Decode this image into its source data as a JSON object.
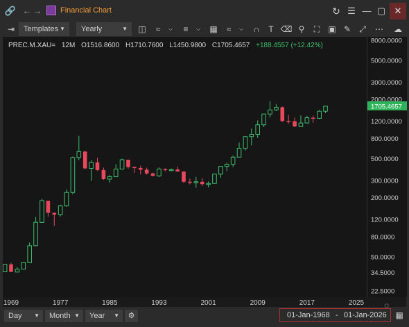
{
  "window": {
    "title": "Financial Chart"
  },
  "toolbar": {
    "templates_label": "Templates",
    "interval_label": "Yearly"
  },
  "legend": {
    "symbol": "PREC.M.XAU=",
    "period": "12M",
    "open": "O1516.8600",
    "high": "H1710.7600",
    "low": "L1450.9800",
    "close": "C1705.4657",
    "change": "+188.4557 (+12.42%)"
  },
  "price_tag": "1705.4657",
  "yaxis_labels": [
    "8000.0000",
    "5000.0000",
    "3000.0000",
    "2000.0000",
    "1200.0000",
    "800.0000",
    "500.0000",
    "300.0000",
    "200.0000",
    "120.0000",
    "80.0000",
    "50.0000",
    "34.5000",
    "22.5000"
  ],
  "xaxis_labels": [
    "1969",
    "1977",
    "1985",
    "1993",
    "2001",
    "2009",
    "2017",
    "2025"
  ],
  "bottom": {
    "day": "Day",
    "month": "Month",
    "year": "Year",
    "date_from": "01-Jan-1968",
    "date_sep": "-",
    "date_to": "01-Jan-2026"
  },
  "colors": {
    "up": "#3fbf6f",
    "down": "#e8485e",
    "accent": "#f29a3a"
  },
  "chart_data": {
    "type": "candlestick",
    "scale": "log",
    "ylim": [
      22.5,
      8000
    ],
    "xlim": [
      1968,
      2026
    ],
    "grid": false,
    "candles": [
      {
        "x": 1968,
        "o": 35.2,
        "h": 42,
        "l": 34.8,
        "c": 41.9
      },
      {
        "x": 1969,
        "o": 41.9,
        "h": 43.5,
        "l": 34.9,
        "c": 35.2
      },
      {
        "x": 1970,
        "o": 35.0,
        "h": 39.2,
        "l": 34.8,
        "c": 37.4
      },
      {
        "x": 1971,
        "o": 37.4,
        "h": 44,
        "l": 37.3,
        "c": 43.6
      },
      {
        "x": 1972,
        "o": 43.7,
        "h": 70,
        "l": 43.6,
        "c": 64.9
      },
      {
        "x": 1973,
        "o": 64.9,
        "h": 127,
        "l": 63.9,
        "c": 112.3
      },
      {
        "x": 1974,
        "o": 112,
        "h": 195,
        "l": 111,
        "c": 186.5
      },
      {
        "x": 1975,
        "o": 186,
        "h": 186,
        "l": 128,
        "c": 140.3
      },
      {
        "x": 1976,
        "o": 140,
        "h": 141,
        "l": 103,
        "c": 134.5
      },
      {
        "x": 1977,
        "o": 134.5,
        "h": 169,
        "l": 129,
        "c": 164.9
      },
      {
        "x": 1978,
        "o": 165,
        "h": 243,
        "l": 161,
        "c": 226
      },
      {
        "x": 1979,
        "o": 226,
        "h": 524,
        "l": 216,
        "c": 512
      },
      {
        "x": 1980,
        "o": 512,
        "h": 850,
        "l": 481,
        "c": 589.5
      },
      {
        "x": 1981,
        "o": 589.5,
        "h": 599,
        "l": 391,
        "c": 397.5
      },
      {
        "x": 1982,
        "o": 397.5,
        "h": 481,
        "l": 297,
        "c": 456.9
      },
      {
        "x": 1983,
        "o": 456.9,
        "h": 509,
        "l": 374,
        "c": 382.4
      },
      {
        "x": 1984,
        "o": 382.4,
        "h": 405,
        "l": 303,
        "c": 309
      },
      {
        "x": 1985,
        "o": 309,
        "h": 340,
        "l": 284,
        "c": 326.8
      },
      {
        "x": 1986,
        "o": 326.8,
        "h": 438,
        "l": 326,
        "c": 390.9
      },
      {
        "x": 1987,
        "o": 390.9,
        "h": 499,
        "l": 390,
        "c": 486.5
      },
      {
        "x": 1988,
        "o": 486.5,
        "h": 485,
        "l": 395,
        "c": 410.2
      },
      {
        "x": 1989,
        "o": 410.2,
        "h": 416,
        "l": 356,
        "c": 401
      },
      {
        "x": 1990,
        "o": 401,
        "h": 423,
        "l": 345,
        "c": 385
      },
      {
        "x": 1991,
        "o": 385,
        "h": 403,
        "l": 344,
        "c": 353.2
      },
      {
        "x": 1992,
        "o": 353.2,
        "h": 360,
        "l": 330,
        "c": 333
      },
      {
        "x": 1993,
        "o": 333,
        "h": 406,
        "l": 326,
        "c": 391.8
      },
      {
        "x": 1994,
        "o": 391.8,
        "h": 397,
        "l": 370,
        "c": 383.3
      },
      {
        "x": 1995,
        "o": 383.3,
        "h": 396,
        "l": 372,
        "c": 387
      },
      {
        "x": 1996,
        "o": 387,
        "h": 415,
        "l": 367,
        "c": 369.2
      },
      {
        "x": 1997,
        "o": 369.2,
        "h": 367,
        "l": 283,
        "c": 290.2
      },
      {
        "x": 1998,
        "o": 290.2,
        "h": 313,
        "l": 273,
        "c": 288.7
      },
      {
        "x": 1999,
        "o": 288.7,
        "h": 326,
        "l": 252,
        "c": 290.3
      },
      {
        "x": 2000,
        "o": 290.3,
        "h": 316,
        "l": 263,
        "c": 274.5
      },
      {
        "x": 2001,
        "o": 274.5,
        "h": 293,
        "l": 255,
        "c": 279
      },
      {
        "x": 2002,
        "o": 279,
        "h": 349,
        "l": 277,
        "c": 347.2
      },
      {
        "x": 2003,
        "o": 347.2,
        "h": 417,
        "l": 319,
        "c": 416.3
      },
      {
        "x": 2004,
        "o": 416.3,
        "h": 456,
        "l": 372,
        "c": 438
      },
      {
        "x": 2005,
        "o": 438,
        "h": 538,
        "l": 411,
        "c": 517
      },
      {
        "x": 2006,
        "o": 517,
        "h": 725,
        "l": 513,
        "c": 635.7
      },
      {
        "x": 2007,
        "o": 635.7,
        "h": 845,
        "l": 603,
        "c": 836.5
      },
      {
        "x": 2008,
        "o": 836.5,
        "h": 1011,
        "l": 681,
        "c": 882.1
      },
      {
        "x": 2009,
        "o": 882.1,
        "h": 1226,
        "l": 810,
        "c": 1104
      },
      {
        "x": 2010,
        "o": 1104,
        "h": 1431,
        "l": 1045,
        "c": 1421
      },
      {
        "x": 2011,
        "o": 1421,
        "h": 1921,
        "l": 1309,
        "c": 1563
      },
      {
        "x": 2012,
        "o": 1563,
        "h": 1796,
        "l": 1522,
        "c": 1664
      },
      {
        "x": 2013,
        "o": 1664,
        "h": 1694,
        "l": 1180,
        "c": 1204
      },
      {
        "x": 2014,
        "o": 1204,
        "h": 1392,
        "l": 1131,
        "c": 1199
      },
      {
        "x": 2015,
        "o": 1199,
        "h": 1307,
        "l": 1046,
        "c": 1061
      },
      {
        "x": 2016,
        "o": 1061,
        "h": 1375,
        "l": 1061,
        "c": 1151
      },
      {
        "x": 2017,
        "o": 1151,
        "h": 1357,
        "l": 1148,
        "c": 1302
      },
      {
        "x": 2018,
        "o": 1302,
        "h": 1366,
        "l": 1160,
        "c": 1282
      },
      {
        "x": 2019,
        "o": 1282,
        "h": 1557,
        "l": 1266,
        "c": 1516.86
      },
      {
        "x": 2020,
        "o": 1516.86,
        "h": 1710.76,
        "l": 1450.98,
        "c": 1705.4657
      }
    ]
  }
}
